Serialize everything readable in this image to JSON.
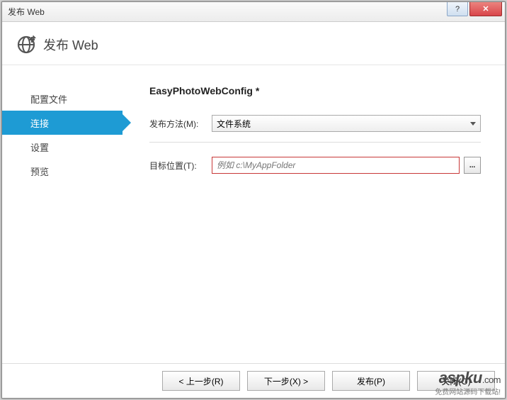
{
  "window": {
    "title": "发布 Web"
  },
  "header": {
    "title": "发布 Web"
  },
  "sidebar": {
    "items": [
      {
        "label": "配置文件",
        "active": false
      },
      {
        "label": "连接",
        "active": true
      },
      {
        "label": "设置",
        "active": false
      },
      {
        "label": "预览",
        "active": false
      }
    ]
  },
  "main": {
    "title": "EasyPhotoWebConfig *",
    "publish_method_label": "发布方法(M):",
    "publish_method_value": "文件系统",
    "target_label": "目标位置(T):",
    "target_placeholder": "例如 c:\\MyAppFolder",
    "target_value": "",
    "browse_label": "..."
  },
  "footer": {
    "prev": "< 上一步(R)",
    "next": "下一步(X) >",
    "publish": "发布(P)",
    "close": "关闭(O)"
  },
  "watermark": {
    "main": "aspku",
    "dotcom": ".com",
    "sub": "免费网站源码下载站!"
  }
}
